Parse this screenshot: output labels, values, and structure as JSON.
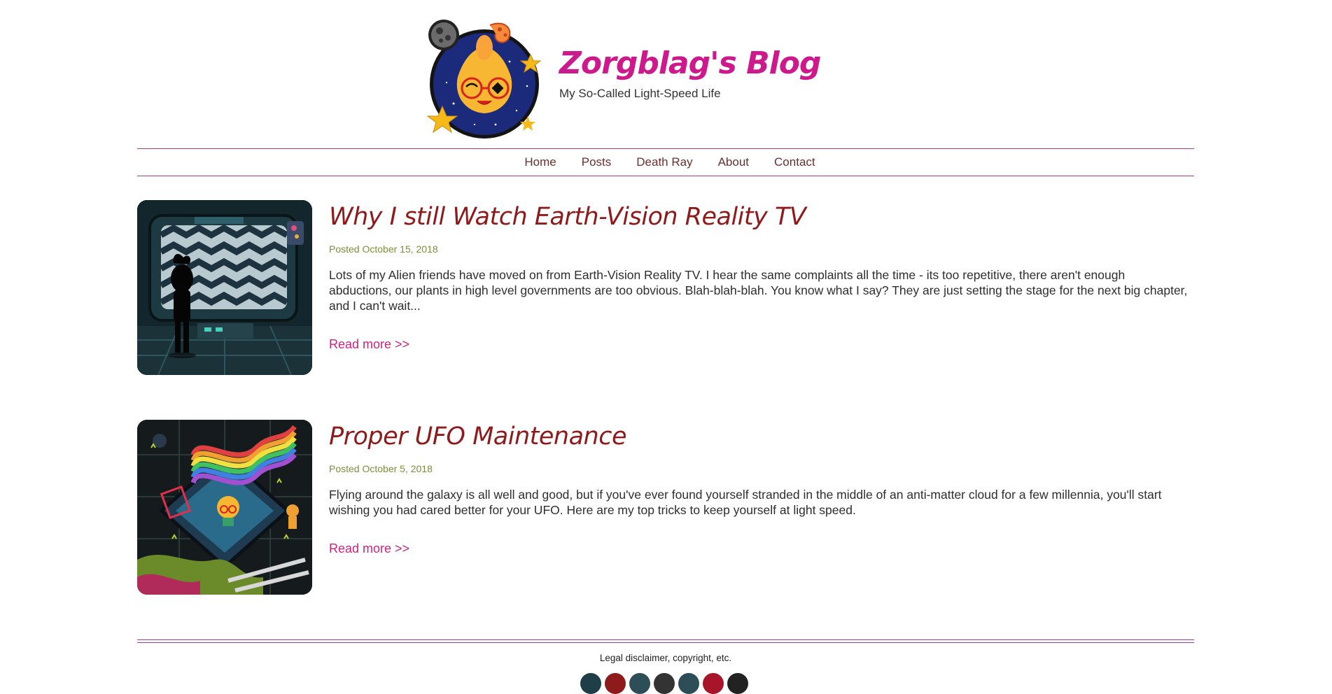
{
  "site": {
    "title": "Zorgblag's Blog",
    "tagline": "My So-Called Light-Speed Life"
  },
  "nav": {
    "items": [
      {
        "label": "Home"
      },
      {
        "label": "Posts"
      },
      {
        "label": "Death Ray"
      },
      {
        "label": "About"
      },
      {
        "label": "Contact"
      }
    ]
  },
  "posts": [
    {
      "title": "Why I still Watch Earth-Vision Reality TV",
      "date": "Posted October 15, 2018",
      "excerpt": "Lots of my Alien friends have moved on from Earth-Vision Reality TV. I hear the same complaints all the time - its too repetitive, there aren't enough abductions, our plants in high level governments are too obvious. Blah-blah-blah. You know what I say? They are just setting the stage for the next big chapter, and I can't wait...",
      "read_more": "Read more >>"
    },
    {
      "title": "Proper UFO Maintenance",
      "date": "Posted October 5, 2018",
      "excerpt": "Flying around the galaxy is all well and good, but if you've ever found yourself stranded in the middle of an anti-matter cloud for a few millennia, you'll start wishing you had cared better for your UFO. Here are my top tricks to keep yourself at light speed.",
      "read_more": "Read more >>"
    }
  ],
  "footer": {
    "legal": "Legal disclaimer, copyright, etc."
  },
  "colors": {
    "brand_pink": "#cc1a8c",
    "title_red": "#8e1b1b",
    "date_green": "#7a8f3a",
    "rule_purple": "#9b3f98",
    "link_pink": "#c5267f"
  },
  "icons": {
    "logo": "alien-mascot-logo",
    "social": [
      "social-icon",
      "social-icon",
      "social-icon",
      "social-icon",
      "social-icon",
      "social-icon",
      "social-icon"
    ]
  }
}
